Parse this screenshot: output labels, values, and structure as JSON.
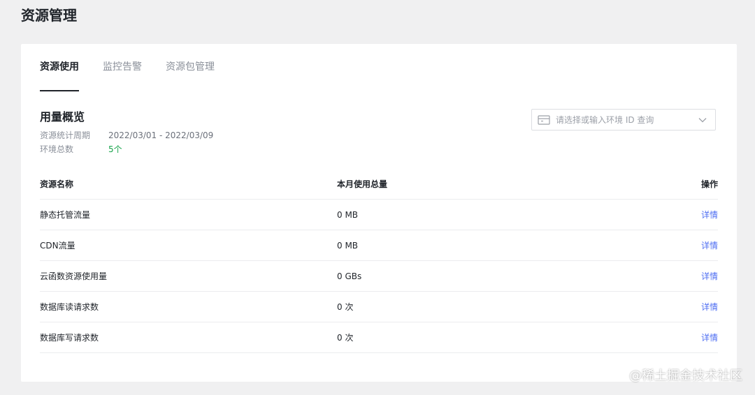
{
  "page": {
    "title": "资源管理"
  },
  "tabs": [
    {
      "label": "资源使用",
      "active": true
    },
    {
      "label": "监控告警",
      "active": false
    },
    {
      "label": "资源包管理",
      "active": false
    }
  ],
  "overview": {
    "title": "用量概览",
    "period_label": "资源统计周期",
    "period_value": "2022/03/01 - 2022/03/09",
    "env_count_label": "环境总数",
    "env_count_value": "5个"
  },
  "env_select": {
    "placeholder": "请选择或输入环境 ID 查询",
    "icon": "calendar-icon"
  },
  "table": {
    "headers": [
      "资源名称",
      "本月使用总量",
      "操作"
    ],
    "rows": [
      {
        "name": "静态托管流量",
        "usage": "0 MB",
        "action": "详情"
      },
      {
        "name": "CDN流量",
        "usage": "0 MB",
        "action": "详情"
      },
      {
        "name": "云函数资源使用量",
        "usage": "0 GBs",
        "action": "详情"
      },
      {
        "name": "数据库读请求数",
        "usage": "0 次",
        "action": "详情"
      },
      {
        "name": "数据库写请求数",
        "usage": "0 次",
        "action": "详情"
      }
    ]
  },
  "watermark": "@稀土掘金技术社区",
  "colors": {
    "accent": "#4e6ef2",
    "success": "#16a34a",
    "background": "#f0f0f1"
  }
}
